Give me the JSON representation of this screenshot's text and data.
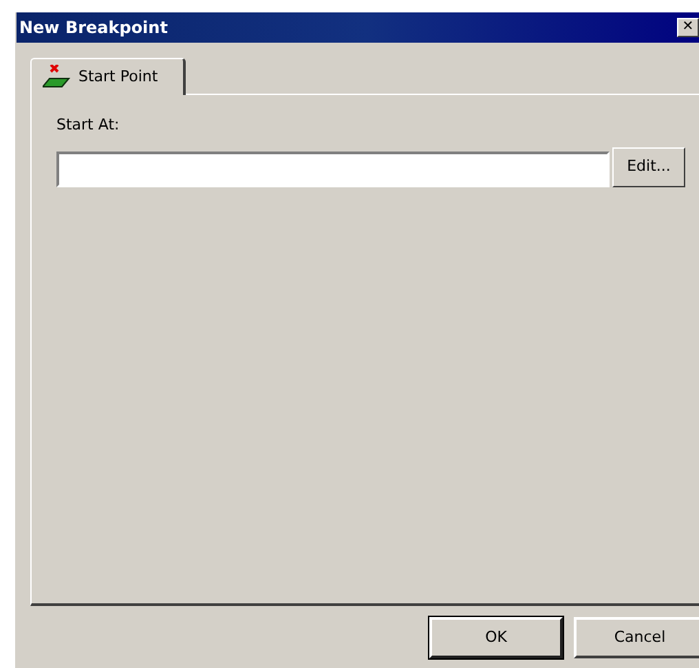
{
  "window": {
    "title": "New Breakpoint",
    "close": "✕"
  },
  "tabs": [
    {
      "label": "Start Point",
      "selected": true
    }
  ],
  "start_at": {
    "label": "Start At:",
    "edit_button": "Edit..."
  },
  "buttons": [
    "OK",
    "Cancel"
  ]
}
